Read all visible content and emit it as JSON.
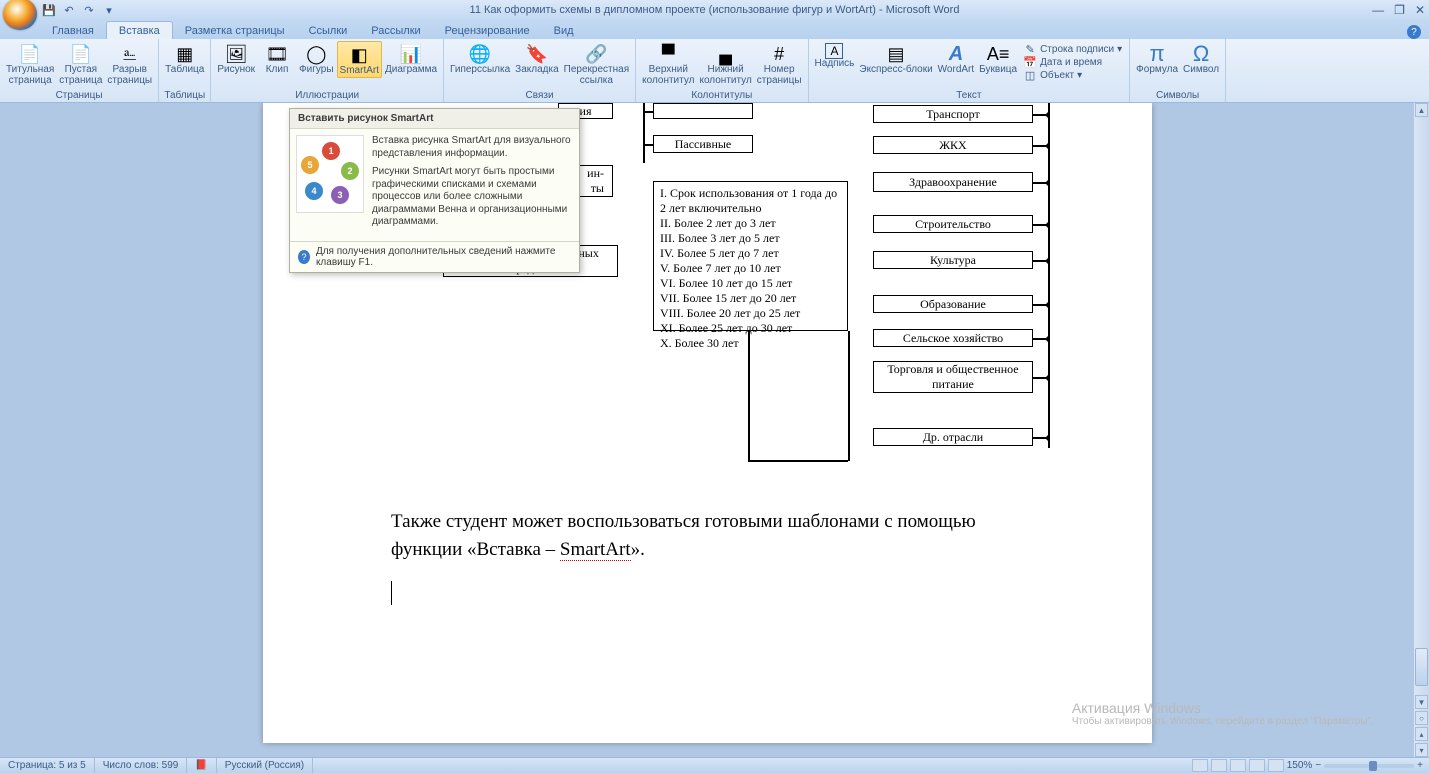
{
  "title": "11 Как оформить схемы в дипломном проекте (использование фигур и WortArt) - Microsoft Word",
  "tabs": [
    "Главная",
    "Вставка",
    "Разметка страницы",
    "Ссылки",
    "Рассылки",
    "Рецензирование",
    "Вид"
  ],
  "activeTab": 1,
  "ribbon": {
    "groups": {
      "pages": {
        "label": "Страницы",
        "items": [
          "Титульная\nстраница",
          "Пустая\nстраница",
          "Разрыв\nстраницы"
        ]
      },
      "tables": {
        "label": "Таблицы",
        "items": [
          "Таблица"
        ]
      },
      "illus": {
        "label": "Иллюстрации",
        "items": [
          "Рисунок",
          "Клип",
          "Фигуры",
          "SmartArt",
          "Диаграмма"
        ]
      },
      "links": {
        "label": "Связи",
        "items": [
          "Гиперссылка",
          "Закладка",
          "Перекрестная\nссылка"
        ]
      },
      "headfoot": {
        "label": "Колонтитулы",
        "items": [
          "Верхний\nколонтитул",
          "Нижний\nколонтитул",
          "Номер\nстраницы"
        ]
      },
      "text": {
        "label": "Текст",
        "big": [
          "Надпись",
          "Экспресс-блоки",
          "WordArt",
          "Буквица"
        ],
        "small": [
          "Строка подписи",
          "Дата и время",
          "Объект"
        ]
      },
      "symbols": {
        "label": "Символы",
        "items": [
          "Формула",
          "Символ"
        ]
      }
    }
  },
  "tooltip": {
    "title": "Вставить рисунок SmartArt",
    "p1": "Вставка рисунка SmartArt для визуального представления информации.",
    "p2": "Рисунки SmartArt могут быть простыми графическими списками и схемами процессов или более сложными диаграммами Венна и организационными диаграммами.",
    "help": "Для получения дополнительных сведений нажмите клавишу F1."
  },
  "diagram": {
    "passive": "Пассивные",
    "listTitle": "I. Срок использования от 1 года до 2 лет включительно",
    "list": [
      "II. Более 2 лет до 3 лет",
      "III. Более 3 лет до 5 лет",
      "IV. Более 5 лет до 7 лет",
      "V. Более 7 лет до 10 лет",
      "VI. Более 10 лет до 15 лет",
      "VII. Более 15 лет до 20 лет",
      "VIII. Более 20 лет до 25 лет",
      "XI. Более 25 лет до 30 лет",
      "X. Более 30 лет"
    ],
    "farRight": [
      "Транспорт",
      "ЖКХ",
      "Здравоохранение",
      "Строительство",
      "Культура",
      "Образование",
      "Сельское хозяйство",
      "Торговля и общественное питание"
    ],
    "farRightLast": "Др. отрасли",
    "bottomLeft": "Прочие объекты основных средств",
    "leftStub": "ия",
    "leftStub2": "ин-\nты"
  },
  "doctext": {
    "line1": "Также студент может воспользоваться готовыми шаблонами с помощью функции «Вставка – ",
    "smartart": "SmartArt",
    "line1b": "»."
  },
  "status": {
    "page": "Страница: 5 из 5",
    "words": "Число слов: 599",
    "lang": "Русский (Россия)",
    "zoom": "150%"
  },
  "watermark": {
    "l1": "Активация Windows",
    "l2": "Чтобы активировать Windows, перейдите в раздел \"Параметры\"."
  }
}
